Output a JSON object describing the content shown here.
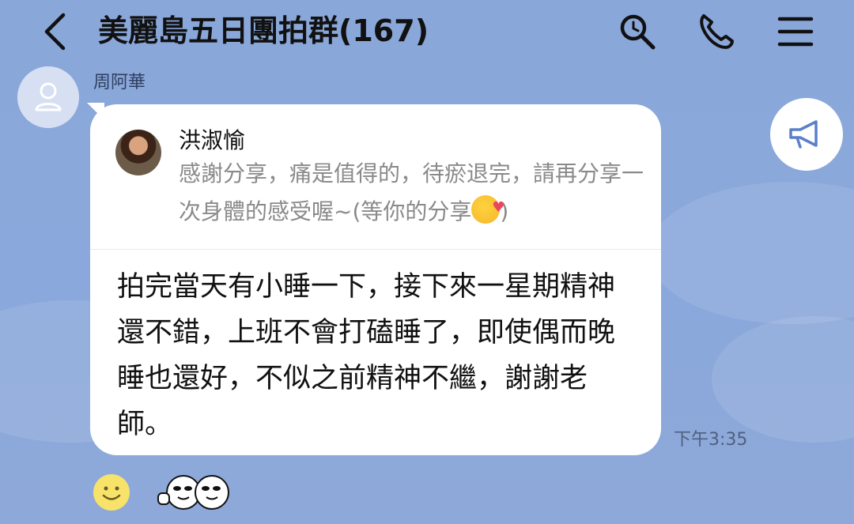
{
  "header": {
    "title": "美麗島五日團拍群(167)",
    "icons": [
      "back-chevron-icon",
      "search-icon",
      "phone-icon",
      "menu-icon"
    ]
  },
  "message": {
    "sender": "周阿華",
    "reply": {
      "name": "洪淑愉",
      "text": "感謝分享，痛是值得的，待瘀退完，請再分享一次身體的感受喔~(等你的分享",
      "text_end": ")",
      "emoji": "smiling-face-with-hearts"
    },
    "body": "拍完當天有小睡一下，接下來一星期精神還不錯，上班不會打磕睡了，即使偶而晚睡也還好，不似之前精神不繼，謝謝老師。",
    "time": "下午3:35"
  },
  "reactions": [
    "smile-icon",
    "thumbs-up-sticker"
  ],
  "colors": {
    "background": "#8aa7d9",
    "bubble": "#ffffff",
    "reply_text": "#8a8a8a",
    "header_text": "#111111"
  }
}
